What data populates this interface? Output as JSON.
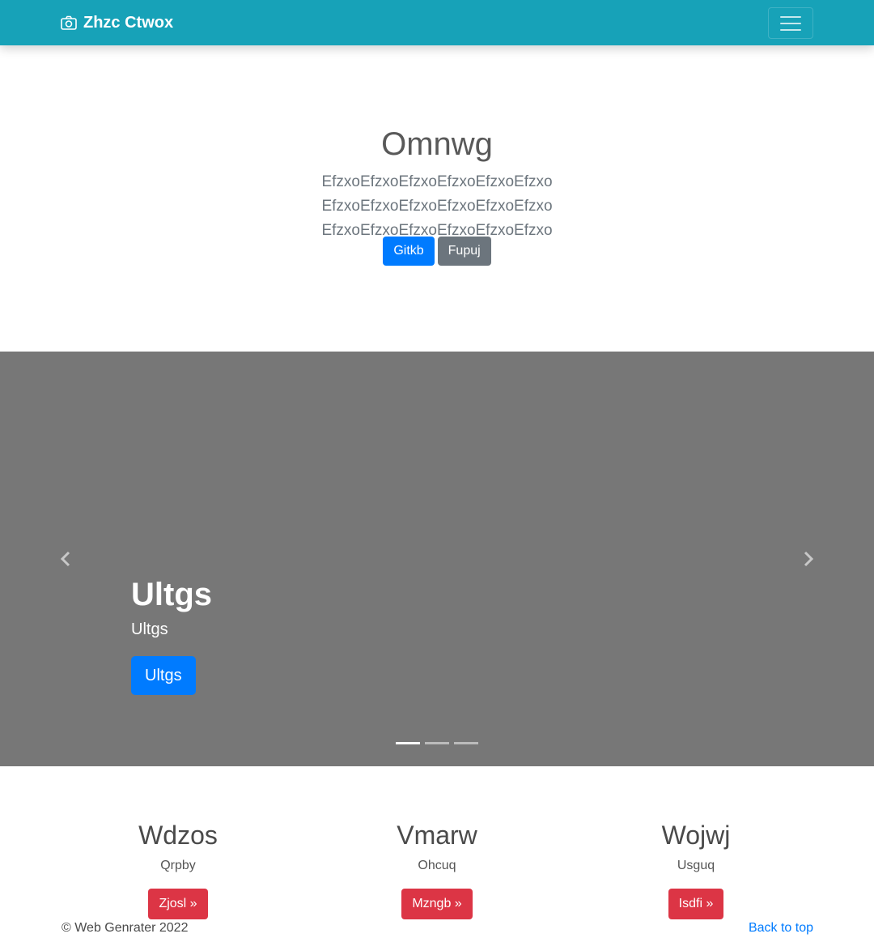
{
  "navbar": {
    "brand": "Zhzc Ctwox",
    "brand_icon": "camera-icon",
    "toggle_icon": "hamburger-menu-icon",
    "bg_color": "#17a2b8"
  },
  "hero": {
    "title": "Omnwg",
    "lead": "EfzxoEfzxoEfzxoEfzxoEfzxoEfzxo EfzxoEfzxoEfzxoEfzxoEfzxoEfzxo EfzxoEfzxoEfzxoEfzxoEfzxoEfzxo",
    "primary_button": "Gitkb",
    "secondary_button": "Fupuj"
  },
  "carousel": {
    "caption_title": "Ultgs",
    "caption_text": "Ultgs",
    "caption_button": "Ultgs",
    "prev_icon": "chevron-left-icon",
    "next_icon": "chevron-right-icon",
    "slide_count": 3,
    "active_slide": 1,
    "bg_color": "#777777"
  },
  "columns": [
    {
      "title": "Wdzos",
      "text": "Qrpby",
      "button": "Zjosl »"
    },
    {
      "title": "Vmarw",
      "text": "Ohcuq",
      "button": "Mzngb »"
    },
    {
      "title": "Wojwj",
      "text": "Usguq",
      "button": "Isdfi »"
    }
  ],
  "footer": {
    "copyright": "© Web Genrater 2022",
    "back_to_top": "Back to top"
  },
  "colors": {
    "primary": "#007bff",
    "secondary": "#6c757d",
    "danger": "#dc3545"
  }
}
